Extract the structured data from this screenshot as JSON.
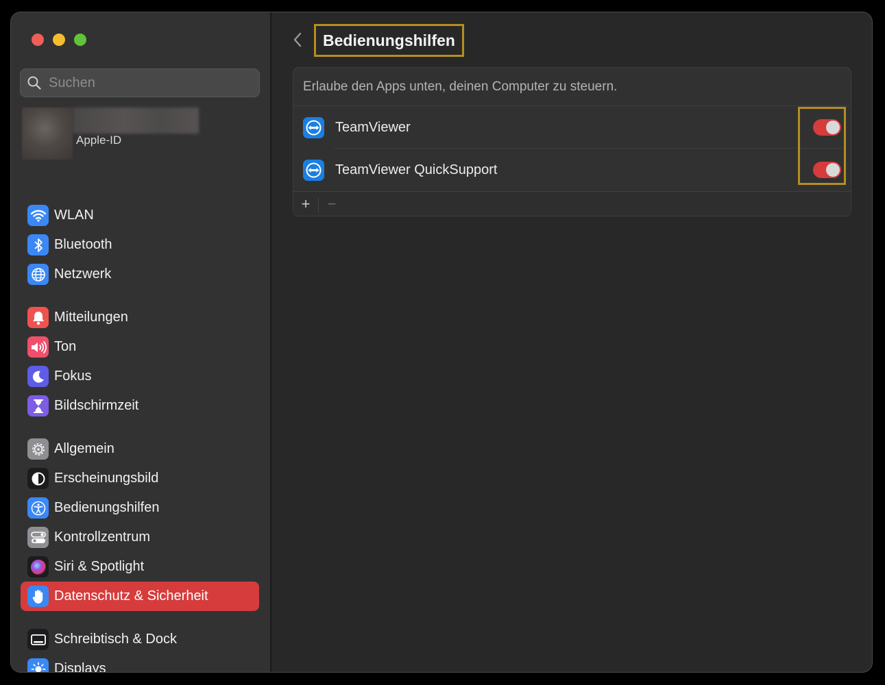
{
  "sidebar": {
    "search_placeholder": "Suchen",
    "account_label": "Apple-ID",
    "items": [
      {
        "label": "WLAN",
        "icon": "wifi-icon",
        "color": "#3a88f5"
      },
      {
        "label": "Bluetooth",
        "icon": "bluetooth-icon",
        "color": "#3a88f5"
      },
      {
        "label": "Netzwerk",
        "icon": "globe-icon",
        "color": "#3a88f5"
      },
      {
        "label": "Mitteilungen",
        "icon": "bell-icon",
        "color": "#ef5350"
      },
      {
        "label": "Ton",
        "icon": "speaker-icon",
        "color": "#ef4f6b"
      },
      {
        "label": "Fokus",
        "icon": "moon-icon",
        "color": "#5e5ce6"
      },
      {
        "label": "Bildschirmzeit",
        "icon": "hourglass-icon",
        "color": "#7d5ce6"
      },
      {
        "label": "Allgemein",
        "icon": "gear-icon",
        "color": "#8e8e93"
      },
      {
        "label": "Erscheinungsbild",
        "icon": "appearance-icon",
        "color": "#1c1c1e"
      },
      {
        "label": "Bedienungshilfen",
        "icon": "accessibility-icon",
        "color": "#3a88f5"
      },
      {
        "label": "Kontrollzentrum",
        "icon": "control-center-icon",
        "color": "#8e8e93"
      },
      {
        "label": "Siri & Spotlight",
        "icon": "siri-icon",
        "color": "#2b2b6b"
      },
      {
        "label": "Datenschutz & Sicherheit",
        "icon": "hand-icon",
        "color": "#3a88f5",
        "selected": true
      },
      {
        "label": "Schreibtisch & Dock",
        "icon": "dock-icon",
        "color": "#1c1c1e"
      },
      {
        "label": "Displays",
        "icon": "sun-icon",
        "color": "#3a88f5"
      }
    ]
  },
  "main": {
    "title": "Bedienungshilfen",
    "description": "Erlaube den Apps unten, deinen Computer zu steuern.",
    "apps": [
      {
        "name": "TeamViewer",
        "icon": "teamviewer-icon",
        "enabled": true
      },
      {
        "name": "TeamViewer QuickSupport",
        "icon": "teamviewer-icon",
        "enabled": true
      }
    ],
    "add_label": "+",
    "remove_label": "−"
  },
  "colors": {
    "accent": "#d63c3c",
    "highlight": "#b58e20"
  }
}
